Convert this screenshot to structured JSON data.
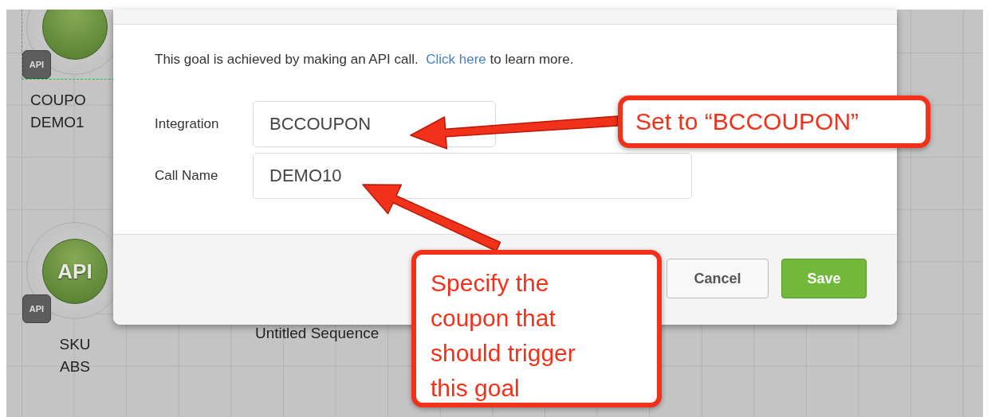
{
  "canvas": {
    "nodes": [
      {
        "badge": "API",
        "label": [
          "COUPO",
          "DEMO1"
        ],
        "selected": true
      },
      {
        "title": "API",
        "badge": "API",
        "label": [
          "SKU",
          "ABS"
        ],
        "selected": false
      }
    ],
    "sequence_label": "Untitled Sequence"
  },
  "dialog": {
    "intro": "This goal is achieved by making an API call.",
    "link": "Click here",
    "intro_tail": "to learn more.",
    "fields": [
      {
        "label": "Integration",
        "value": "BCCOUPON"
      },
      {
        "label": "Call Name",
        "value": "DEMO10"
      }
    ],
    "buttons": [
      {
        "label": "Cancel",
        "kind": "secondary"
      },
      {
        "label": "Save",
        "kind": "primary"
      }
    ]
  },
  "annotations": [
    {
      "text": "Set to “BCCOUPON”"
    },
    {
      "text": "Specify the coupon that should trigger this goal"
    }
  ]
}
